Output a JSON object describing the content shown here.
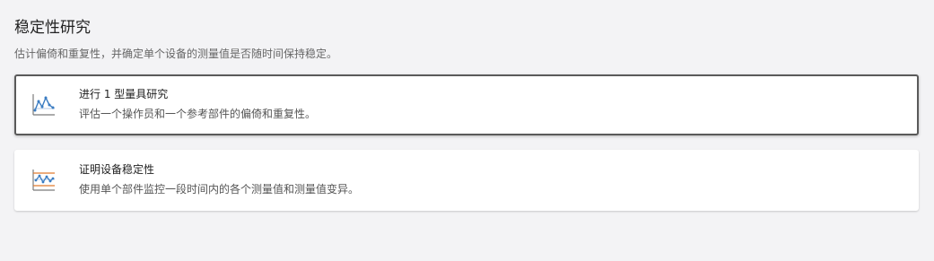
{
  "page": {
    "title": "稳定性研究",
    "subtitle": "估计偏倚和重复性，并确定单个设备的测量值是否随时间保持稳定。"
  },
  "options": [
    {
      "title": "进行 1 型量具研究",
      "description": "评估一个操作员和一个参考部件的偏倚和重复性。",
      "icon": "type1-gage-chart-icon",
      "selected": true
    },
    {
      "title": "证明设备稳定性",
      "description": "使用单个部件监控一段时间内的各个测量值和测量值变异。",
      "icon": "control-chart-icon",
      "selected": false
    }
  ],
  "colors": {
    "background": "#f3f3f5",
    "card": "#ffffff",
    "selected_border": "#5a5a5a",
    "icon_blue": "#3a7cc2",
    "icon_orange": "#e07a2e"
  }
}
